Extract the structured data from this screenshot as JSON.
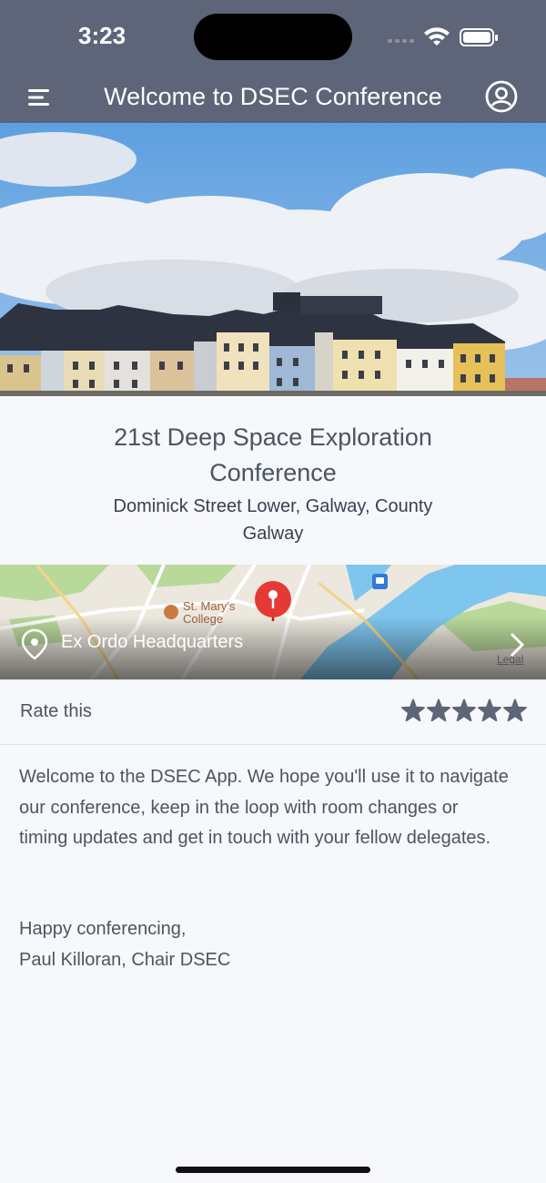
{
  "status_bar": {
    "time": "3:23",
    "icons": [
      "signal-icon",
      "wifi-icon",
      "battery-icon"
    ]
  },
  "nav": {
    "title": "Welcome to DSEC Conference",
    "menu_icon": "hamburger-icon",
    "profile_icon": "user-circle-icon"
  },
  "conference": {
    "title": "21st Deep Space Exploration Conference",
    "address": "Dominick Street Lower, Galway, County Galway"
  },
  "map": {
    "location_label": "Ex Ordo Headquarters",
    "poi_label": "St. Mary's College",
    "legal": "Legal"
  },
  "rating": {
    "label": "Rate this",
    "max_stars": 5,
    "value": 0
  },
  "welcome": {
    "body": "Welcome to the DSEC App. We hope you'll use it to navigate our conference, keep in the loop with room changes or timing updates and get in touch with your fellow delegates.",
    "signoff_line1": "Happy conferencing,",
    "signoff_line2": "Paul Killoran, Chair DSEC"
  },
  "colors": {
    "header_bg": "#5e6578",
    "page_bg": "#f6f8fb",
    "star_color": "#5e6578",
    "pin_red": "#e53935"
  }
}
